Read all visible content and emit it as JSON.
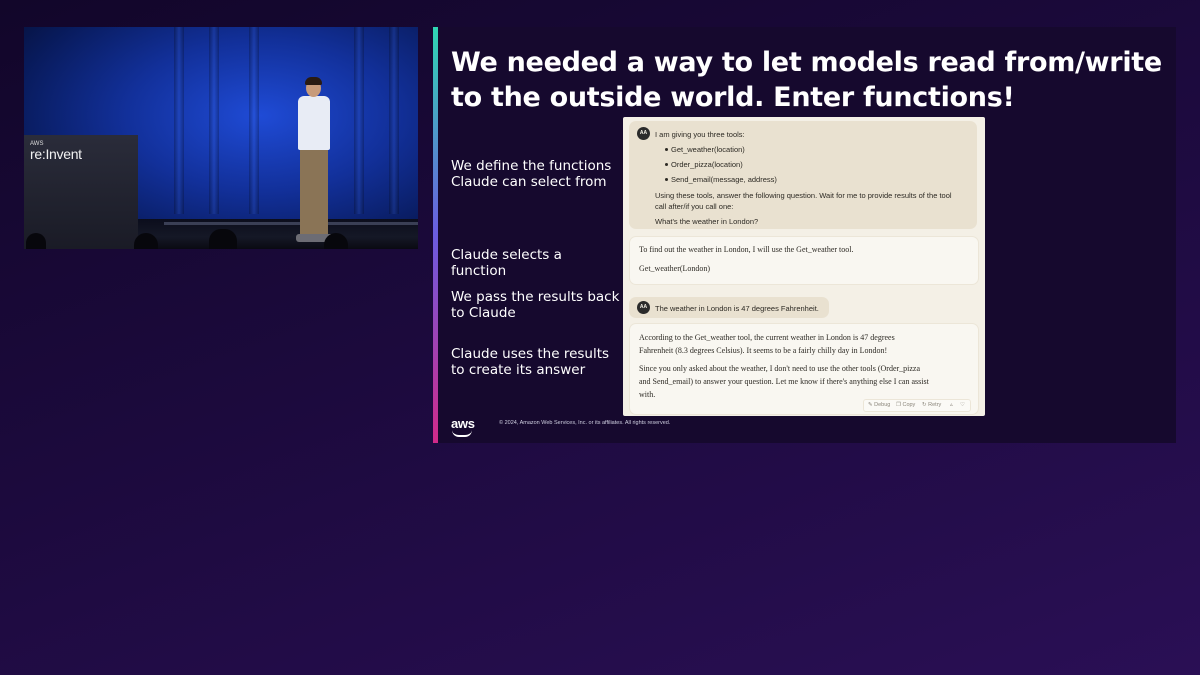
{
  "video": {
    "event_logo_small": "AWS",
    "event_logo": "re:Invent"
  },
  "slide": {
    "title": "We needed a way to let models read from/write to the outside world. Enter functions!",
    "steps": [
      "We define the functions Claude can select from",
      "Claude selects a function",
      "We pass the results back to Claude",
      "Claude uses the results to create its answer"
    ],
    "footer_logo": "aws",
    "copyright": "© 2024, Amazon Web Services, Inc. or its affiliates. All rights reserved."
  },
  "chat": {
    "user_avatar": "AA",
    "prompt": {
      "intro": "I am giving you three tools:",
      "tools": [
        "Get_weather(location)",
        "Order_pizza(location)",
        "Send_email(message, address)"
      ],
      "instruction_line1": "Using these tools, answer the following question. Wait for me to provide results of the tool",
      "instruction_line2": "call after/if you call one:",
      "question": "What's the weather in London?"
    },
    "reply1": {
      "line1": "To find out the weather in London, I will use the Get_weather tool.",
      "call": "Get_weather(London)"
    },
    "tool_result": "The weather in London is 47 degrees Fahrenheit.",
    "reply2": {
      "p1_line1": "According to the Get_weather tool, the current weather in London is 47 degrees",
      "p1_line2": "Fahrenheit (8.3 degrees Celsius). It seems to be a fairly chilly day in London!",
      "p2_line1": "Since you only asked about the weather, I don't need to use the other tools (Order_pizza",
      "p2_line2": "and Send_email) to answer your question. Let me know if there's anything else I can assist",
      "p2_line3": "with."
    },
    "actions": {
      "debug": "Debug",
      "copy": "Copy",
      "retry": "Retry"
    }
  }
}
